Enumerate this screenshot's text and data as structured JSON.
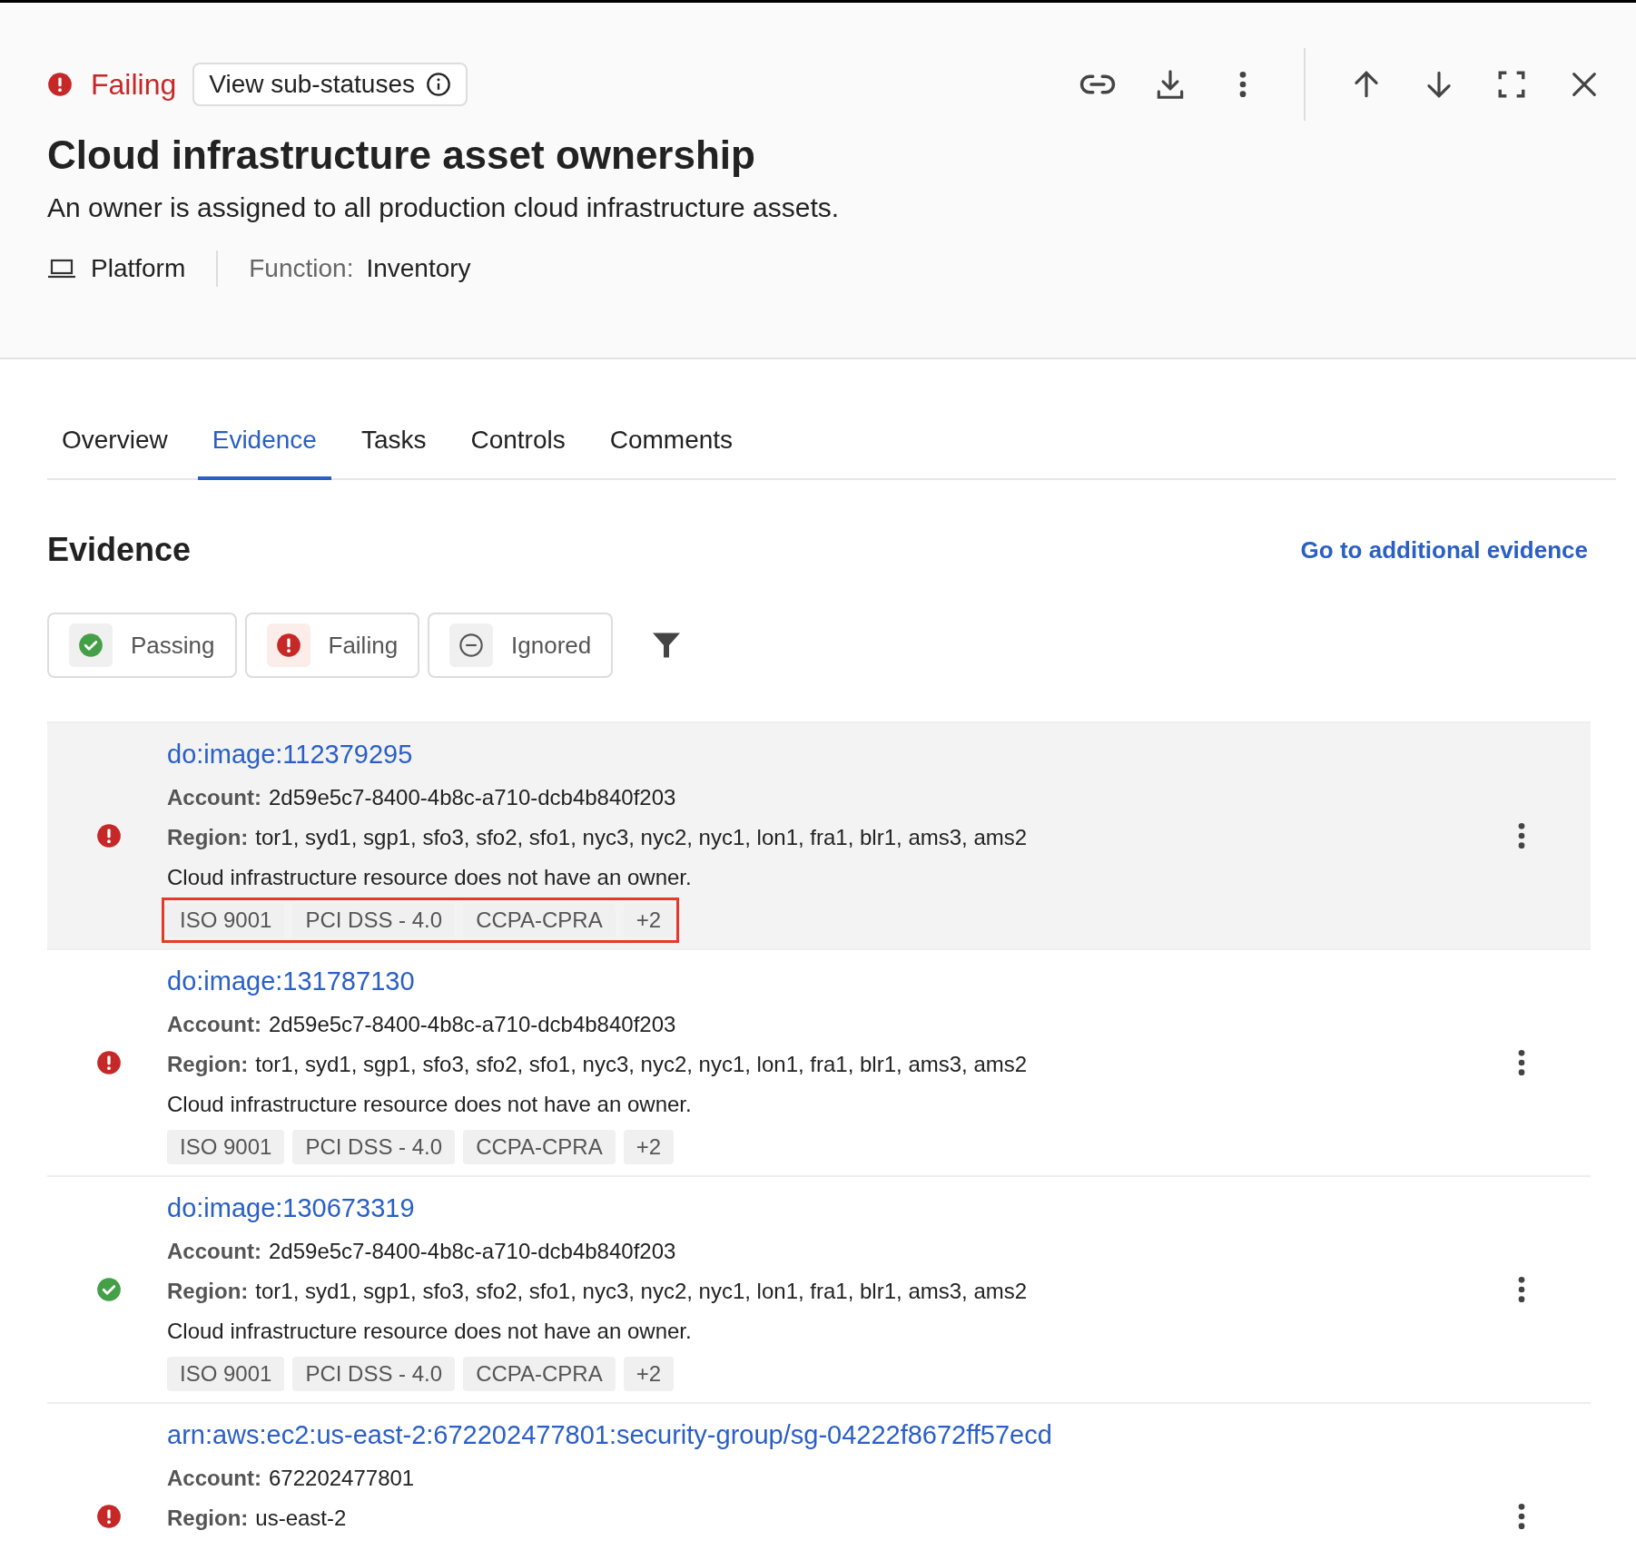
{
  "header": {
    "status": {
      "kind": "failing",
      "label": "Failing"
    },
    "sub_status_button": "View sub-statuses",
    "title": "Cloud infrastructure asset ownership",
    "description": "An owner is assigned to all production cloud infrastructure assets.",
    "category": "Platform",
    "function_label": "Function:",
    "function_value": "Inventory"
  },
  "tabs": [
    {
      "label": "Overview",
      "selected": false
    },
    {
      "label": "Evidence",
      "selected": true
    },
    {
      "label": "Tasks",
      "selected": false
    },
    {
      "label": "Controls",
      "selected": false
    },
    {
      "label": "Comments",
      "selected": false
    }
  ],
  "section": {
    "title": "Evidence",
    "link": "Go to additional evidence"
  },
  "filters": [
    {
      "kind": "passing",
      "label": "Passing"
    },
    {
      "kind": "failing",
      "label": "Failing"
    },
    {
      "kind": "ignored",
      "label": "Ignored"
    }
  ],
  "rows": [
    {
      "kind": "failing",
      "selected": true,
      "title": "do:image:112379295",
      "account_label": "Account:",
      "account": "2d59e5c7-8400-4b8c-a710-dcb4b840f203",
      "region_label": "Region:",
      "region": "tor1, syd1, sgp1, sfo3, sfo2, sfo1, nyc3, nyc2, nyc1, lon1, fra1, blr1, ams3, ams2",
      "message": "Cloud infrastructure resource does not have an owner.",
      "tags": [
        "ISO 9001",
        "PCI DSS - 4.0",
        "CCPA-CPRA",
        "+2"
      ],
      "tags_highlighted": true
    },
    {
      "kind": "failing",
      "selected": false,
      "title": "do:image:131787130",
      "account_label": "Account:",
      "account": "2d59e5c7-8400-4b8c-a710-dcb4b840f203",
      "region_label": "Region:",
      "region": "tor1, syd1, sgp1, sfo3, sfo2, sfo1, nyc3, nyc2, nyc1, lon1, fra1, blr1, ams3, ams2",
      "message": "Cloud infrastructure resource does not have an owner.",
      "tags": [
        "ISO 9001",
        "PCI DSS - 4.0",
        "CCPA-CPRA",
        "+2"
      ],
      "tags_highlighted": false
    },
    {
      "kind": "passing",
      "selected": false,
      "title": "do:image:130673319",
      "account_label": "Account:",
      "account": "2d59e5c7-8400-4b8c-a710-dcb4b840f203",
      "region_label": "Region:",
      "region": "tor1, syd1, sgp1, sfo3, sfo2, sfo1, nyc3, nyc2, nyc1, lon1, fra1, blr1, ams3, ams2",
      "message": "Cloud infrastructure resource does not have an owner.",
      "tags": [
        "ISO 9001",
        "PCI DSS - 4.0",
        "CCPA-CPRA",
        "+2"
      ],
      "tags_highlighted": false
    },
    {
      "kind": "failing",
      "selected": false,
      "title": "arn:aws:ec2:us-east-2:672202477801:security-group/sg-04222f8672ff57ecd",
      "account_label": "Account:",
      "account": "672202477801",
      "region_label": "Region:",
      "region": "us-east-2"
    }
  ]
}
